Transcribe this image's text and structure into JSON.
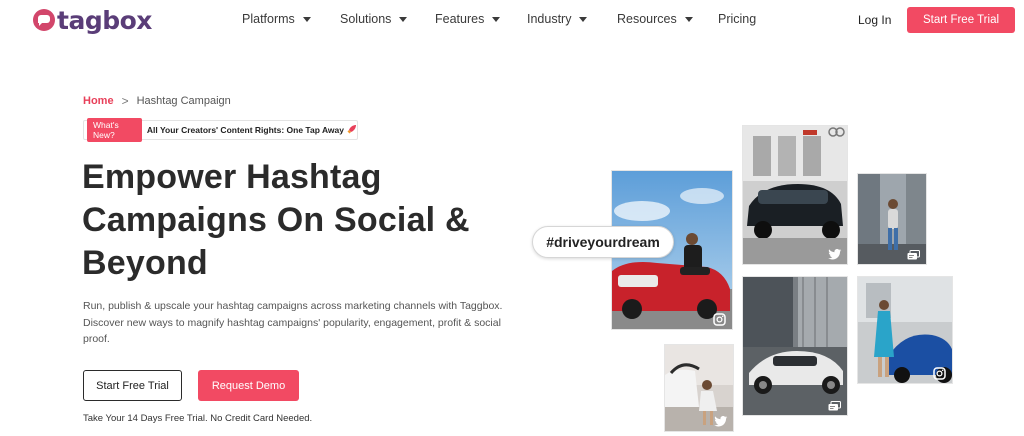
{
  "nav": {
    "logo_text": "tagbox",
    "items": [
      {
        "label": "Platforms",
        "has_caret": true
      },
      {
        "label": "Solutions",
        "has_caret": true
      },
      {
        "label": "Features",
        "has_caret": true
      },
      {
        "label": "Industry",
        "has_caret": true
      },
      {
        "label": "Resources",
        "has_caret": true
      },
      {
        "label": "Pricing",
        "has_caret": false
      }
    ],
    "login_label": "Log In",
    "cta_label": "Start Free Trial"
  },
  "breadcrumb": {
    "home": "Home",
    "separator": ">",
    "current": "Hashtag Campaign"
  },
  "news": {
    "badge": "What's New?",
    "text": "All Your Creators' Content Rights: One Tap Away"
  },
  "hero": {
    "headline": [
      "Empower Hashtag",
      "Campaigns On Social &",
      "Beyond"
    ],
    "description": "Run, publish & upscale your hashtag campaigns across marketing channels with Taggbox. Discover new ways to magnify hashtag campaigns' popularity, engagement, profit & social proof.",
    "primary_button": "Start Free Trial",
    "secondary_button": "Request Demo",
    "note": "Take Your 14 Days Free Trial. No Credit Card Needed."
  },
  "collage": {
    "hashtag": "#driveyourdream",
    "photos": [
      {
        "name": "photo-woman-on-red-mini",
        "network": "instagram-icon"
      },
      {
        "name": "photo-black-audi-parking",
        "network": "twitter-icon"
      },
      {
        "name": "photo-woman-city-street",
        "network": "message-icon"
      },
      {
        "name": "photo-white-audi-r8",
        "network": "message-icon"
      },
      {
        "name": "photo-woman-blue-porsche",
        "network": "instagram-icon"
      },
      {
        "name": "photo-woman-car-trunk",
        "network": "twitter-icon"
      }
    ]
  },
  "colors": {
    "accent": "#f24a63",
    "logo": "#5a3d78",
    "headline": "#2b2b2b"
  }
}
